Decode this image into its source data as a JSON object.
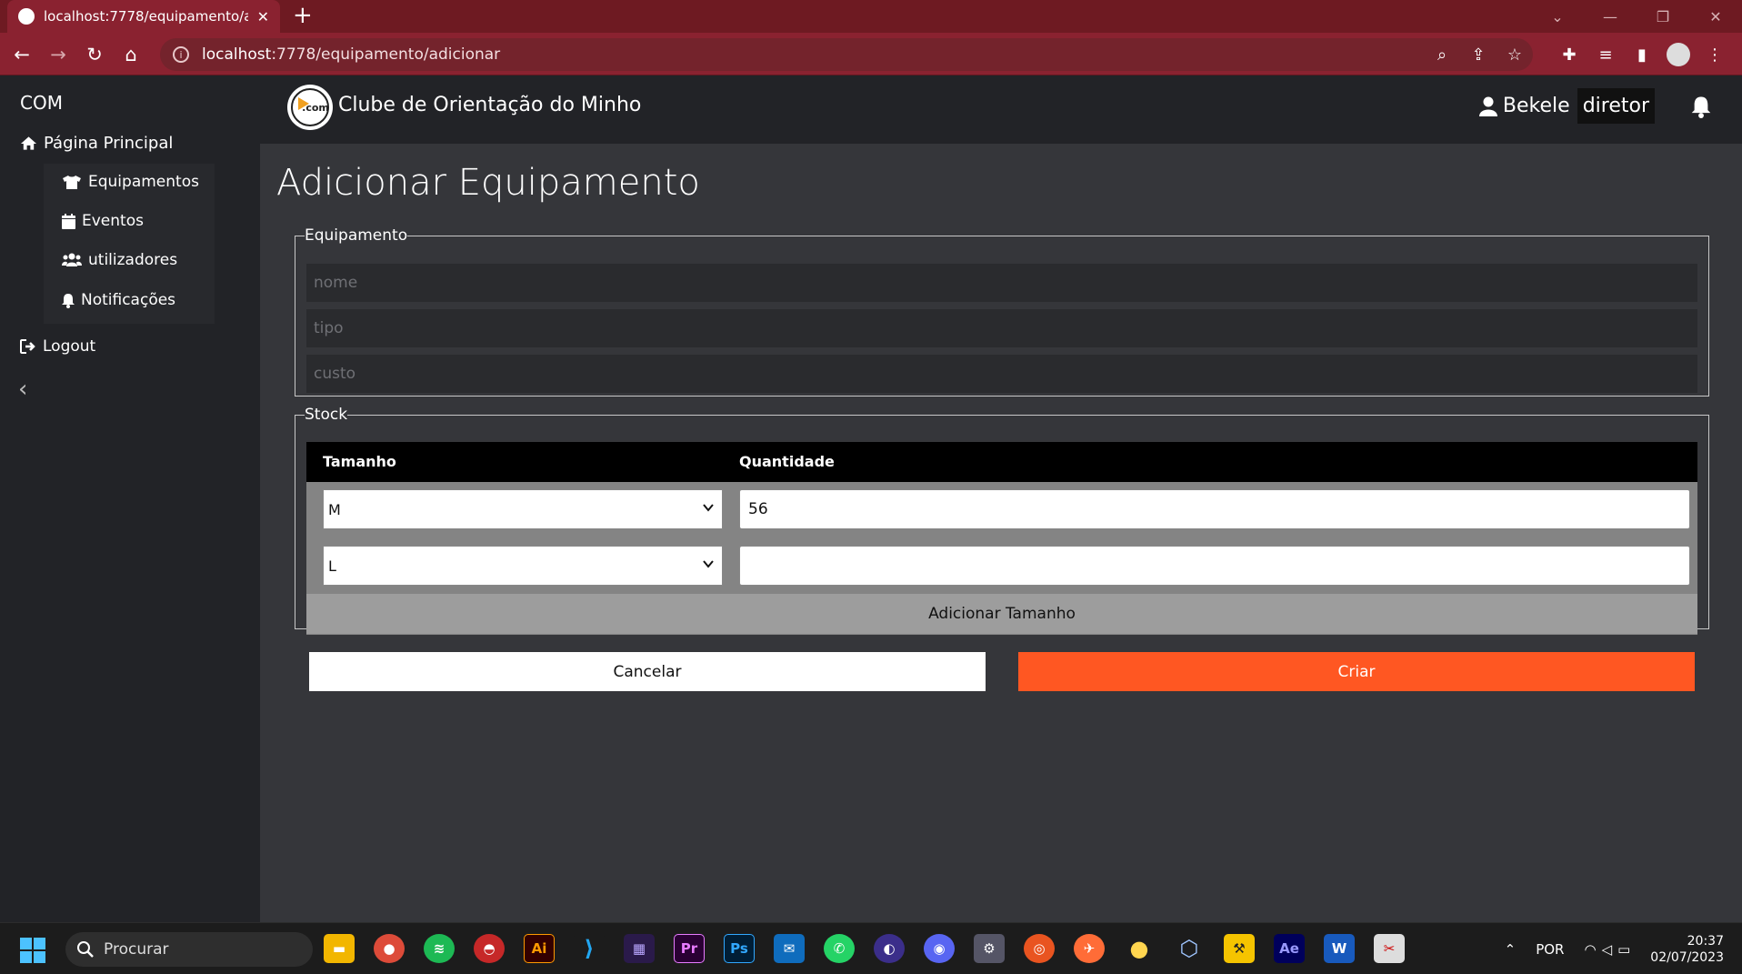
{
  "browser": {
    "tab_title": "localhost:7778/equipamento/adi",
    "tab_close": "✕",
    "new_tab": "+",
    "url_host": "localhost",
    "url_path": ":7778/equipamento/adicionar",
    "accent": "#8a2230"
  },
  "sidebar": {
    "brand": "COM",
    "home": "Página Principal",
    "items": [
      {
        "label": "Equipamentos",
        "icon": "shirt-icon"
      },
      {
        "label": "Eventos",
        "icon": "calendar-icon"
      },
      {
        "label": "utilizadores",
        "icon": "users-icon"
      },
      {
        "label": "Notificações",
        "icon": "bell-icon"
      }
    ],
    "logout": "Logout",
    "collapse": "‹"
  },
  "header": {
    "club_name": "Clube de Orientação do Minho",
    "logo_text": ".com",
    "user_name": "Bekele",
    "role": "diretor"
  },
  "page": {
    "title": "Adicionar Equipamento"
  },
  "equipamento": {
    "legend": "Equipamento",
    "nome_placeholder": "nome",
    "tipo_placeholder": "tipo",
    "custo_placeholder": "custo"
  },
  "stock": {
    "legend": "Stock",
    "col_tamanho": "Tamanho",
    "col_quantidade": "Quantidade",
    "rows": [
      {
        "tamanho": "M",
        "quantidade": "56"
      },
      {
        "tamanho": "L",
        "quantidade": ""
      }
    ],
    "add_label": "Adicionar Tamanho"
  },
  "actions": {
    "cancel": "Cancelar",
    "create": "Criar",
    "create_color": "#ff5722"
  },
  "taskbar": {
    "search_label": "Procurar",
    "language": "POR",
    "time": "20:37",
    "date": "02/07/2023"
  }
}
